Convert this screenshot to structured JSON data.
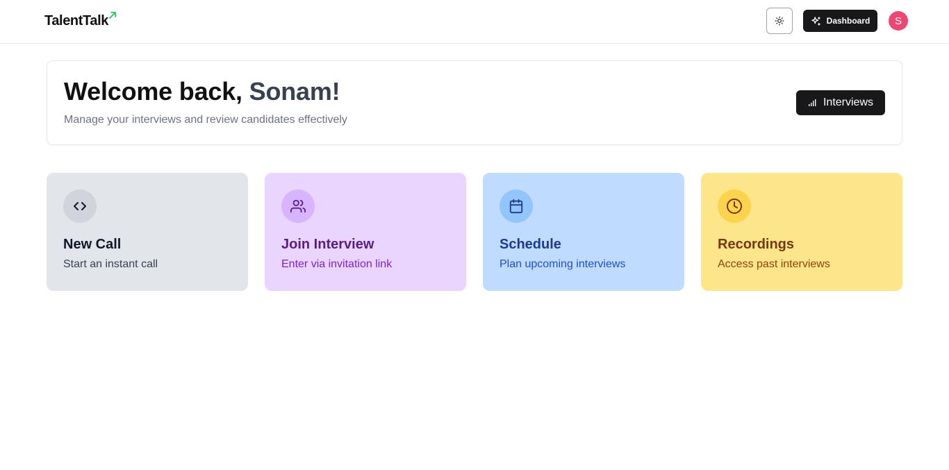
{
  "header": {
    "logo_text": "TalentTalk",
    "dashboard_label": "Dashboard",
    "avatar_initial": "S"
  },
  "welcome": {
    "greeting": "Welcome back, ",
    "name": "Sonam!",
    "subtitle": "Manage your interviews and review candidates effectively",
    "interviews_label": "Interviews"
  },
  "actions": [
    {
      "title": "New Call",
      "description": "Start an instant call",
      "icon": "code-icon",
      "bg": "#e2e5ea",
      "circle": "#d1d5db",
      "title_color": "#111827",
      "desc_color": "#374151",
      "icon_color": "#111827"
    },
    {
      "title": "Join Interview",
      "description": "Enter via invitation link",
      "icon": "users-icon",
      "bg": "#e9d5ff",
      "circle": "#d8b4fe",
      "title_color": "#581c87",
      "desc_color": "#7e22ce",
      "icon_color": "#581c87"
    },
    {
      "title": "Schedule",
      "description": "Plan upcoming interviews",
      "icon": "calendar-icon",
      "bg": "#bfdbfe",
      "circle": "#93c5fd",
      "title_color": "#1e3a8a",
      "desc_color": "#1d4ed8",
      "icon_color": "#1e3a8a"
    },
    {
      "title": "Recordings",
      "description": "Access past interviews",
      "icon": "clock-icon",
      "bg": "#fde68a",
      "circle": "#fcd34d",
      "title_color": "#78350f",
      "desc_color": "#92400e",
      "icon_color": "#78350f"
    }
  ]
}
